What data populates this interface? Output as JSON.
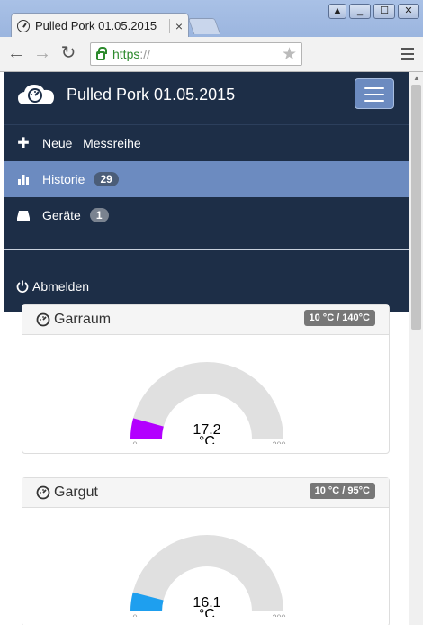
{
  "browser": {
    "tab_title": "Pulled Pork 01.05.2015",
    "tab_close": "×",
    "url_scheme": "https",
    "url_rest": "://",
    "window_buttons": [
      "▲",
      "_",
      "☐",
      "✕"
    ]
  },
  "navbar": {
    "brand_title": "Pulled Pork 01.05.2015",
    "items": [
      {
        "label": "Neue   Messreihe",
        "icon": "plus-icon",
        "badge": null
      },
      {
        "label": "Historie",
        "icon": "bar-chart-icon",
        "badge": "29",
        "active": true
      },
      {
        "label": "Geräte",
        "icon": "drive-icon",
        "badge": "1"
      }
    ],
    "logout_label": "Abmelden"
  },
  "sensors": [
    {
      "name": "Garraum",
      "range_label": "10 °C / 140°C",
      "value": "17.2",
      "unit": "°C",
      "value_num": 17.2,
      "min": "0",
      "max": "200",
      "color": "#b300ff"
    },
    {
      "name": "Gargut",
      "range_label": "10 °C / 95°C",
      "value": "16.1",
      "unit": "°C",
      "value_num": 16.1,
      "min": "0",
      "max": "200",
      "color": "#1e9fef"
    }
  ],
  "colors": {
    "navbar_bg": "#1d2e47",
    "active_bg": "#6c8bc0",
    "gauge_track": "#e0e0e0"
  }
}
